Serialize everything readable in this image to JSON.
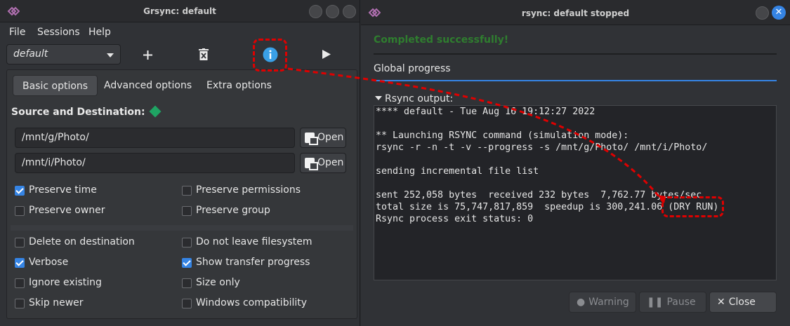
{
  "left_window": {
    "title": "Grsync: default",
    "menu": [
      "File",
      "Sessions",
      "Help"
    ],
    "session_select": "default",
    "toolbar_icons": [
      "add-icon",
      "delete-icon",
      "info-icon",
      "run-icon"
    ],
    "tabs": [
      "Basic options",
      "Advanced options",
      "Extra options"
    ],
    "source_destination_title": "Source and Destination:",
    "source_path": "/mnt/g/Photo/",
    "destination_path": "/mnt/i/Photo/",
    "open_label": "Open",
    "options": [
      {
        "label": "Preserve time",
        "checked": true
      },
      {
        "label": "Preserve permissions",
        "checked": false
      },
      {
        "label": "Preserve owner",
        "checked": false
      },
      {
        "label": "Preserve group",
        "checked": false
      },
      {
        "label": "Delete on destination",
        "checked": false
      },
      {
        "label": "Do not leave filesystem",
        "checked": false
      },
      {
        "label": "Verbose",
        "checked": true
      },
      {
        "label": "Show transfer progress",
        "checked": true
      },
      {
        "label": "Ignore existing",
        "checked": false
      },
      {
        "label": "Size only",
        "checked": false
      },
      {
        "label": "Skip newer",
        "checked": false
      },
      {
        "label": "Windows compatibility",
        "checked": false
      }
    ]
  },
  "right_window": {
    "title": "rsync: default stopped",
    "status": "Completed successfully!",
    "global_progress_label": "Global progress",
    "rsync_output_label": "Rsync output:",
    "output_lines": [
      "**** default - Tue Aug 16 19:12:27 2022",
      "",
      "** Launching RSYNC command (simulation mode):",
      "rsync -r -n -t -v --progress -s /mnt/g/Photo/ /mnt/i/Photo/",
      "",
      "sending incremental file list",
      "",
      "sent 252,058 bytes  received 232 bytes  7,762.77 bytes/sec",
      "total size is 75,747,817,859  speedup is 300,241.06 (DRY RUN)",
      "Rsync process exit status: 0"
    ],
    "buttons": {
      "warning": "Warning",
      "pause": "Pause",
      "close": "Close"
    }
  },
  "colors": {
    "accent": "#3584e4",
    "success_text": "#2f7d2f",
    "highlight": "#e00000"
  }
}
